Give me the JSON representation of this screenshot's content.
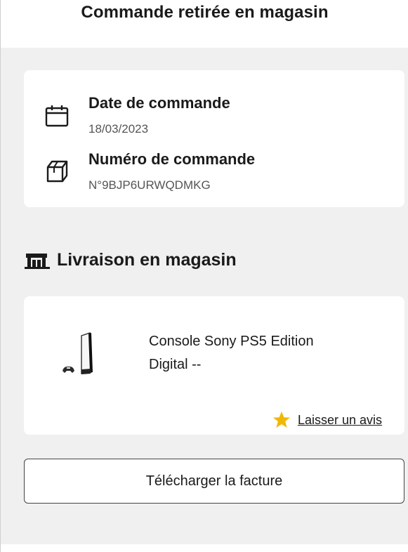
{
  "header": {
    "title": "Commande retirée en magasin"
  },
  "order_info": {
    "date": {
      "icon": "calendar-icon",
      "label": "Date de commande",
      "value": "18/03/2023"
    },
    "number": {
      "icon": "package-icon",
      "label": "Numéro de commande",
      "value": "N°9BJP6URWQDMKG"
    }
  },
  "delivery": {
    "icon": "store-icon",
    "title": "Livraison en magasin",
    "product": {
      "image": "ps5-console-image",
      "name_line1": "Console Sony PS5 Edition",
      "name_line2": "Digital --"
    },
    "review": {
      "icon": "star-icon",
      "label": "Laisser un avis",
      "color": "#f2b705"
    }
  },
  "actions": {
    "download_invoice_label": "Télécharger la facture"
  }
}
